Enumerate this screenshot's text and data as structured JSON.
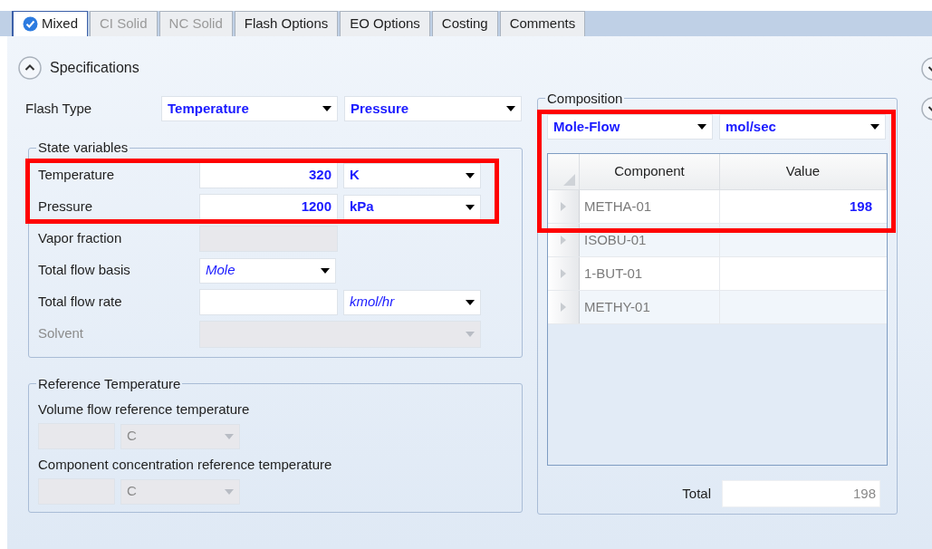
{
  "tabs": [
    {
      "label": "Mixed",
      "selected": true,
      "disabled": false,
      "complete": true
    },
    {
      "label": "CI Solid",
      "selected": false,
      "disabled": true,
      "complete": false
    },
    {
      "label": "NC Solid",
      "selected": false,
      "disabled": true,
      "complete": false
    },
    {
      "label": "Flash Options",
      "selected": false,
      "disabled": false,
      "complete": false
    },
    {
      "label": "EO Options",
      "selected": false,
      "disabled": false,
      "complete": false
    },
    {
      "label": "Costing",
      "selected": false,
      "disabled": false,
      "complete": false
    },
    {
      "label": "Comments",
      "selected": false,
      "disabled": false,
      "complete": false
    }
  ],
  "section": {
    "title": "Specifications",
    "expanded": true
  },
  "flash_type": {
    "label": "Flash Type",
    "spec_1": "Temperature",
    "spec_2": "Pressure"
  },
  "state_variables": {
    "title": "State variables",
    "rows": [
      {
        "kind": "value_unit",
        "label": "Temperature",
        "value": "320",
        "unit": "K",
        "unit_bold": true,
        "disabled": false
      },
      {
        "kind": "value_unit",
        "label": "Pressure",
        "value": "1200",
        "unit": "kPa",
        "unit_bold": true,
        "disabled": false
      },
      {
        "kind": "field",
        "label": "Vapor fraction",
        "disabled": true
      },
      {
        "kind": "dropdown",
        "label": "Total flow basis",
        "value": "Mole",
        "value_bold": false,
        "disabled": false
      },
      {
        "kind": "value_unit",
        "label": "Total flow rate",
        "unit": "kmol/hr",
        "unit_bold": false,
        "disabled": false
      },
      {
        "kind": "wide_dropdown",
        "label": "Solvent",
        "disabled": true
      }
    ]
  },
  "reference_temperature": {
    "title": "Reference Temperature",
    "items": [
      {
        "label": "Volume flow reference temperature",
        "unit": "C",
        "disabled": true
      },
      {
        "label": "Component concentration reference temperature",
        "unit": "C",
        "disabled": true
      }
    ]
  },
  "composition": {
    "title": "Composition",
    "basis": "Mole-Flow",
    "units": "mol/sec",
    "columns": [
      "Component",
      "Value"
    ],
    "rows": [
      {
        "component": "METHA-01",
        "value": "198"
      },
      {
        "component": "ISOBU-01"
      },
      {
        "component": "1-BUT-01"
      },
      {
        "component": "METHY-01"
      }
    ],
    "total_label": "Total",
    "total": "198"
  }
}
